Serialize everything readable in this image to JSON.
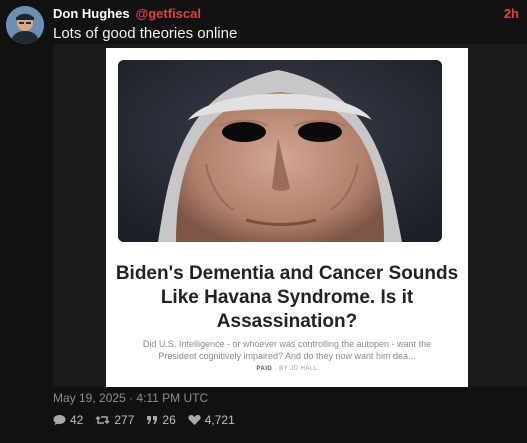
{
  "post": {
    "author_name": "Don Hughes",
    "handle": "@getfiscal",
    "time_ago": "2h",
    "text": "Lots of good theories online",
    "timestamp": "May 19, 2025 · 4:11 PM UTC"
  },
  "link_card": {
    "title": "Biden's Dementia and Cancer Sounds Like Havana Syndrome. Is it Assassination?",
    "description": "Did U.S. Intelligence - or whoever was controlling the autopen - want the President cognitively impaired? And do they now want him dea...",
    "paid_label": "PAID",
    "byline": "BY JD HALL"
  },
  "stats": {
    "replies": "42",
    "reposts": "277",
    "quotes": "26",
    "likes": "4,721"
  },
  "icons": {
    "reply": "comment-bubble-icon",
    "repost": "repost-icon",
    "quote": "quote-icon",
    "like": "heart-icon"
  },
  "colors": {
    "background": "#111111",
    "accent": "#e0413f"
  }
}
